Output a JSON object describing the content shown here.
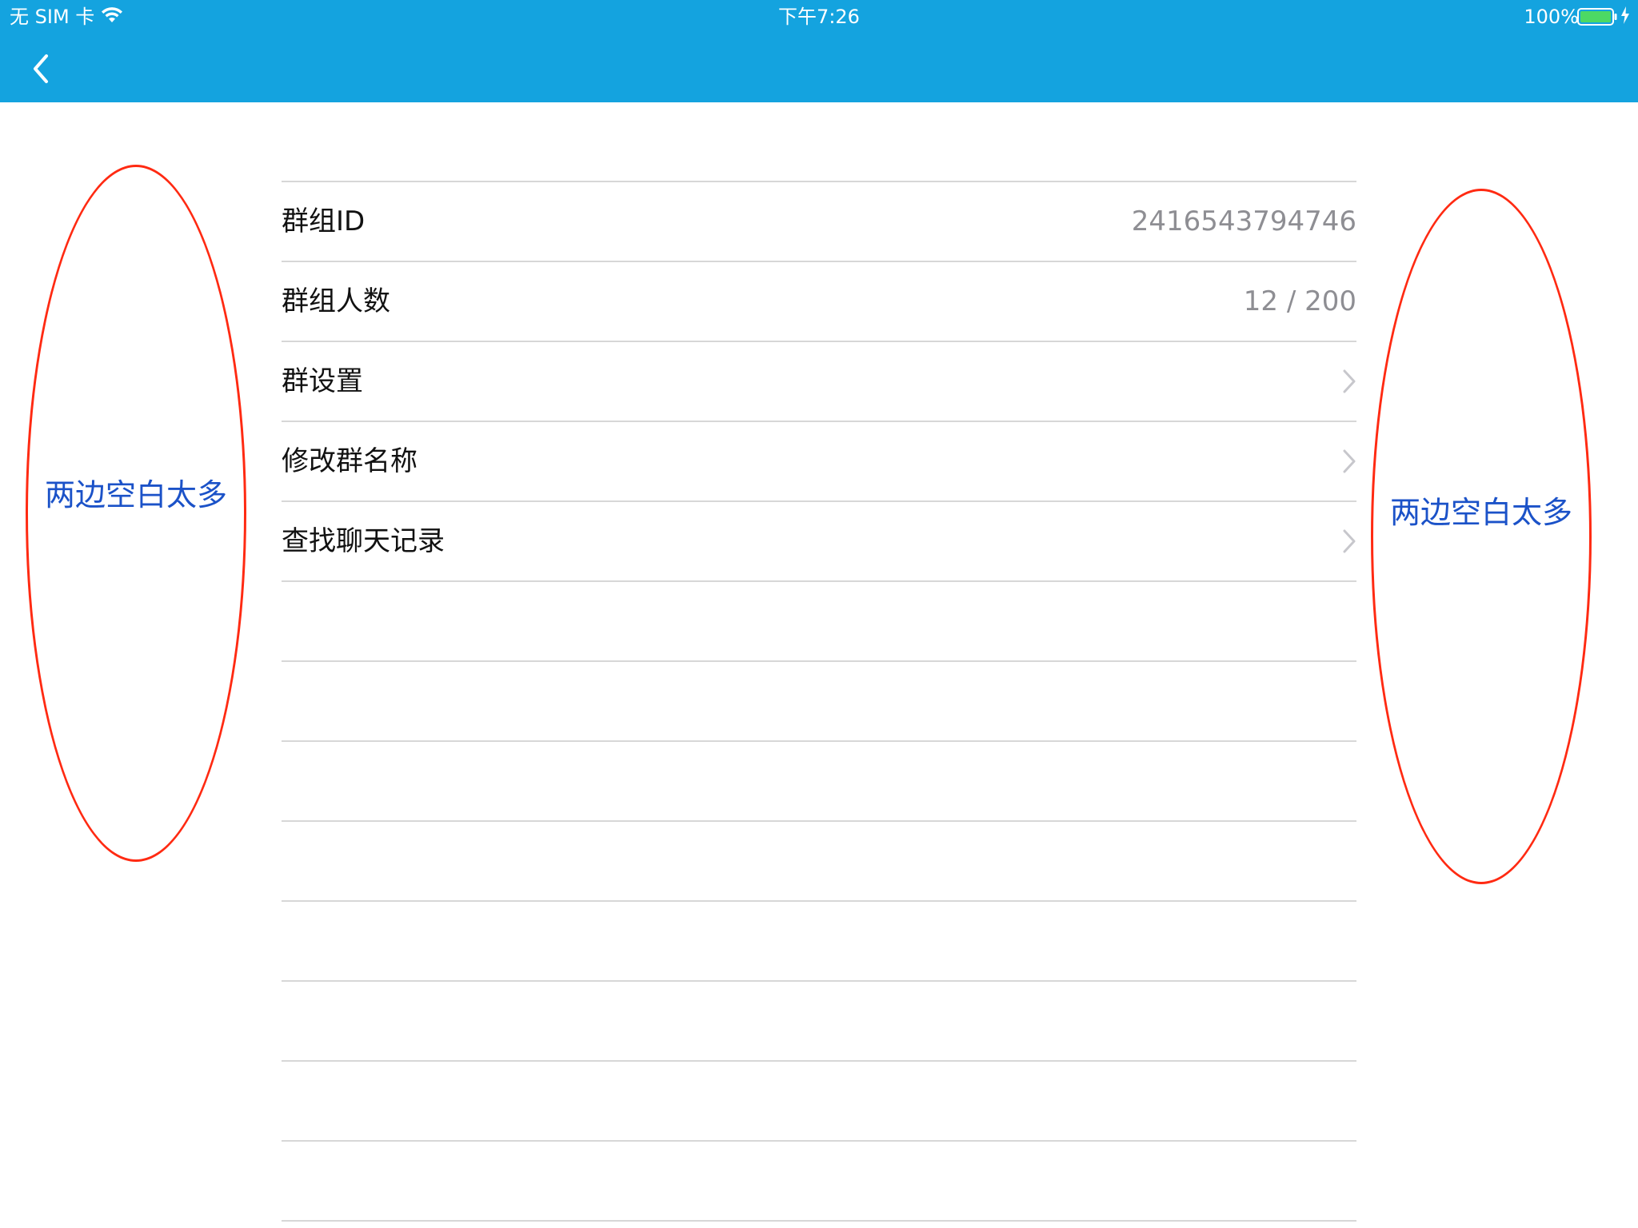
{
  "colors": {
    "nav_bar": "#14a3df",
    "separator": "#d7d7d7",
    "secondary_text": "#8e8e93",
    "annotation_stroke": "#ff2a12",
    "annotation_text": "#1b52c8"
  },
  "status_bar": {
    "carrier": "无 SIM 卡",
    "wifi_icon": "wifi-icon",
    "time": "下午7:26",
    "battery_percent": "100%",
    "battery_icon": "battery-full-icon",
    "charging_icon": "charging-bolt-icon"
  },
  "nav_bar": {
    "back_icon": "chevron-left-icon"
  },
  "table": {
    "rows": [
      {
        "label": "群组ID",
        "value": "2416543794746"
      },
      {
        "label": "群组人数",
        "value": "12 / 200"
      },
      {
        "label": "群设置",
        "icon": "chevron-right-icon"
      },
      {
        "label": "修改群名称",
        "icon": "chevron-right-icon"
      },
      {
        "label": "查找聊天记录",
        "icon": "chevron-right-icon"
      }
    ]
  },
  "annotations": {
    "left": "两边空白太多",
    "right": "两边空白太多"
  }
}
